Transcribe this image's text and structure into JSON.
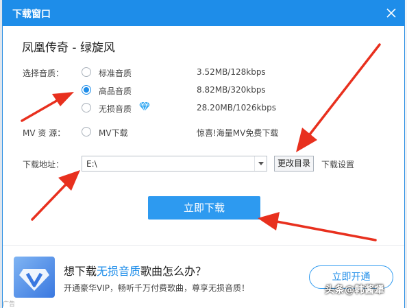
{
  "window": {
    "title": "下载窗口",
    "song_title": "凤凰传奇 - 绿旋风"
  },
  "quality": {
    "label": "选择音质：",
    "options": [
      {
        "label": "标准音质",
        "size": "3.52MB/128kbps",
        "selected": false
      },
      {
        "label": "高品音质",
        "size": "8.82MB/320kbps",
        "selected": true
      },
      {
        "label": "无损音质",
        "size": "28.20MB/1026kbps",
        "selected": false
      }
    ]
  },
  "mv": {
    "label": "MV 资 源：",
    "option_label": "MV下载",
    "promo": "惊喜!海量MV免费下载"
  },
  "path": {
    "label": "下载地址：",
    "value": "E:\\",
    "change_button": "更改目录",
    "settings_link": "下载设置"
  },
  "download_button": "立即下载",
  "promo": {
    "title_prefix": "想下载",
    "title_highlight": "无损音质",
    "title_suffix": "歌曲怎么办？",
    "subtitle": "开通豪华VIP，畅听千万付费歌曲，尊享无损音质！",
    "open_button": "立即开通"
  },
  "ad_label": "广告",
  "watermark": "头条@韩酱犟",
  "colors": {
    "accent": "#1e8de9",
    "arrow": "#e8301e"
  },
  "icons": [
    "close-icon",
    "diamond-icon",
    "dropdown-arrow-icon",
    "vip-logo-icon"
  ]
}
